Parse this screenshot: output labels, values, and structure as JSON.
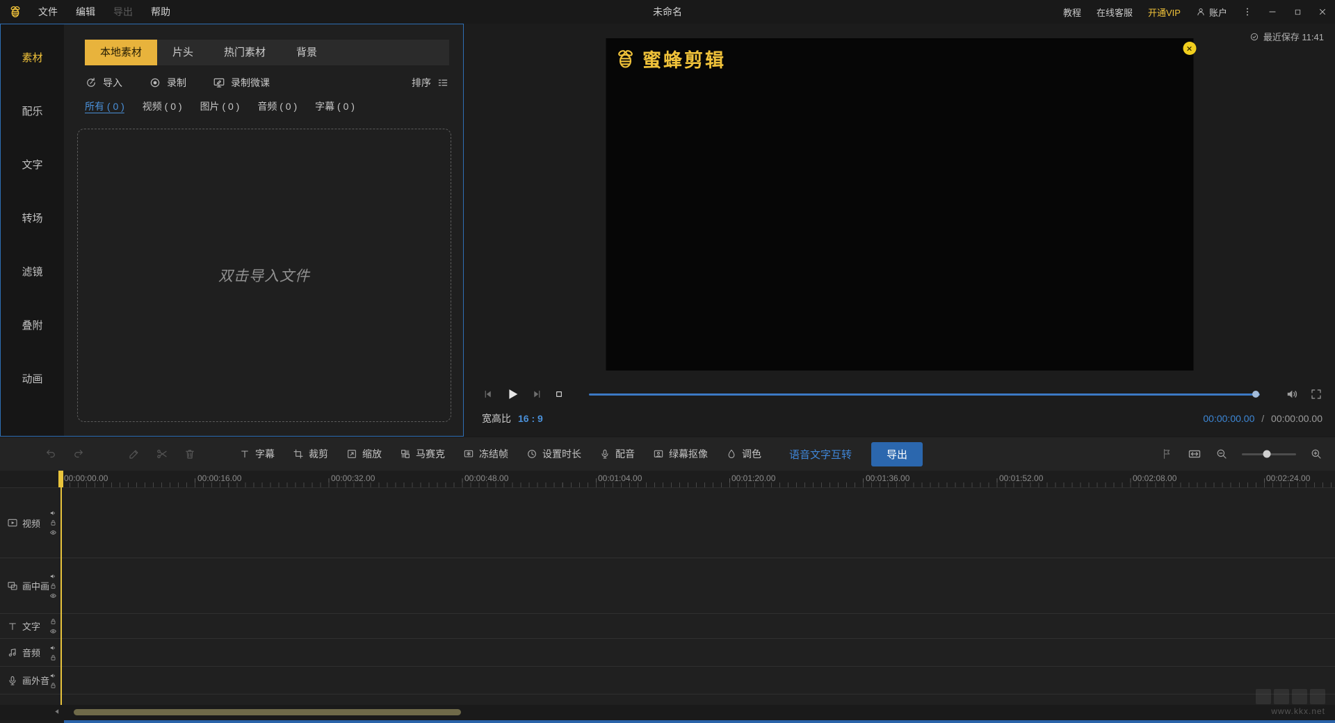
{
  "menubar": {
    "file": "文件",
    "edit": "编辑",
    "export": "导出",
    "help": "帮助",
    "title": "未命名",
    "tutorial": "教程",
    "support": "在线客服",
    "vip": "开通VIP",
    "account": "账户"
  },
  "sidebar": {
    "items": [
      {
        "label": "素材",
        "active": true
      },
      {
        "label": "配乐",
        "active": false
      },
      {
        "label": "文字",
        "active": false
      },
      {
        "label": "转场",
        "active": false
      },
      {
        "label": "滤镜",
        "active": false
      },
      {
        "label": "叠附",
        "active": false
      },
      {
        "label": "动画",
        "active": false
      }
    ]
  },
  "material": {
    "tabs": [
      {
        "label": "本地素材",
        "active": true
      },
      {
        "label": "片头",
        "active": false
      },
      {
        "label": "热门素材",
        "active": false
      },
      {
        "label": "背景",
        "active": false
      }
    ],
    "import_label": "导入",
    "record_label": "录制",
    "lesson_label": "录制微课",
    "sort_label": "排序",
    "filters": [
      {
        "label": "所有 ( 0 )",
        "active": true
      },
      {
        "label": "视频 ( 0 )",
        "active": false
      },
      {
        "label": "图片 ( 0 )",
        "active": false
      },
      {
        "label": "音频 ( 0 )",
        "active": false
      },
      {
        "label": "字幕 ( 0 )",
        "active": false
      }
    ],
    "dropzone": "双击导入文件"
  },
  "preview": {
    "saved": "最近保存 11:41",
    "brand": "蜜蜂剪辑",
    "aspect_label": "宽高比",
    "aspect_value": "16 : 9",
    "time_current": "00:00:00.00",
    "time_sep": "/",
    "time_total": "00:00:00.00"
  },
  "toolbar": {
    "tools": [
      {
        "label": "字幕"
      },
      {
        "label": "裁剪"
      },
      {
        "label": "缩放"
      },
      {
        "label": "马赛克"
      },
      {
        "label": "冻结帧"
      },
      {
        "label": "设置时长"
      },
      {
        "label": "配音"
      },
      {
        "label": "绿幕抠像"
      },
      {
        "label": "调色"
      }
    ],
    "speech": "语音文字互转",
    "export": "导出"
  },
  "timeline": {
    "ticks": [
      "00:00:00.00",
      "00:00:16.00",
      "00:00:32.00",
      "00:00:48.00",
      "00:01:04.00",
      "00:01:20.00",
      "00:01:36.00",
      "00:01:52.00",
      "00:02:08.00",
      "00:02:24.00"
    ],
    "tracks": [
      {
        "label": "视频"
      },
      {
        "label": "画中画"
      },
      {
        "label": "文字"
      },
      {
        "label": "音频"
      },
      {
        "label": "画外音"
      }
    ]
  },
  "watermark": {
    "url": "www.kkx.net"
  },
  "colors": {
    "accent_gold": "#f0c23a",
    "accent_blue": "#3d87d6",
    "panel_border": "#2e6fb5"
  }
}
